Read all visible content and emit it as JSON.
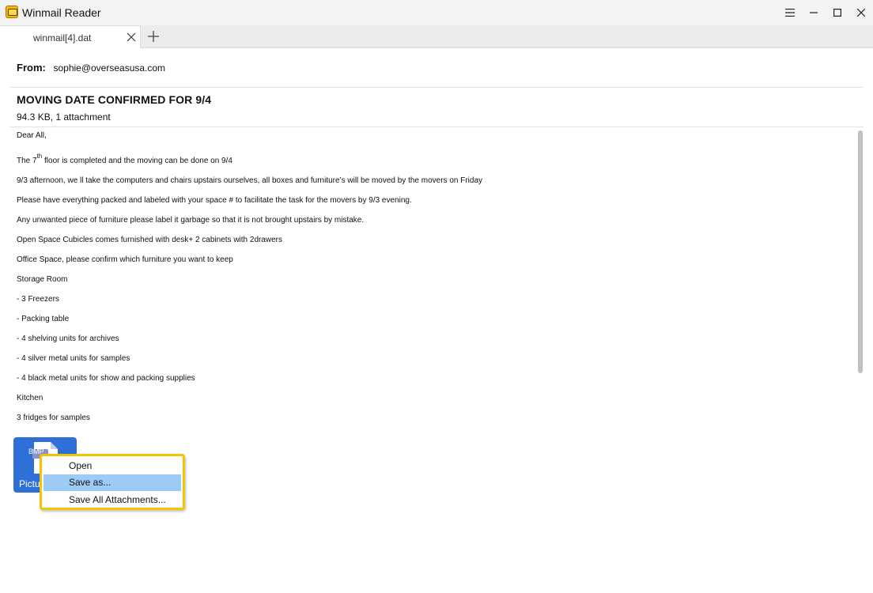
{
  "window": {
    "title": "Winmail Reader",
    "icon": "winmail-app-icon"
  },
  "tabs": [
    {
      "label": "winmail[4].dat",
      "active": true
    }
  ],
  "email": {
    "from_label": "From:",
    "from_value": "sophie@overseasusa.com",
    "subject": "MOVING DATE CONFIRMED FOR 9/4",
    "meta": "94.3 KB, 1 attachment",
    "body": {
      "greeting": "Dear All,",
      "line1_pre": "The 7",
      "line1_sup": "th",
      "line1_post": " floor is completed and the moving can be done on 9/4",
      "line2": "9/3 afternoon, we ll take the computers and chairs upstairs ourselves, all boxes and furniture’s will be moved by the movers on Friday",
      "line3": "Please have everything packed and labeled with your space # to facilitate the task for the movers by 9/3 evening.",
      "line4": "Any unwanted piece of furniture please label it garbage so that it is not brought upstairs by mistake.",
      "line5": "Open Space Cubicles comes furnished with desk+ 2 cabinets with 2drawers",
      "line6": "Office Space, please confirm which furniture you want to keep",
      "line7": "Storage Room",
      "line8": "- 3 Freezers",
      "line9": "- Packing table",
      "line10": "- 4 shelving units for archives",
      "line11": "- 4 silver metal units for samples",
      "line12": "- 4 black metal units for show and packing supplies",
      "line13": "Kitchen",
      "line14": "3 fridges for samples"
    }
  },
  "attachment": {
    "label": "Pictu",
    "type_badge": "BMP"
  },
  "context_menu": {
    "items": [
      {
        "label": "Open",
        "selected": false
      },
      {
        "label": "Save as...",
        "selected": true
      },
      {
        "label": "Save All Attachments...",
        "selected": false
      }
    ]
  },
  "colors": {
    "attachment_tile": "#2f6fd8",
    "menu_highlight": "#9ccbf5",
    "menu_border": "#f4c400"
  }
}
